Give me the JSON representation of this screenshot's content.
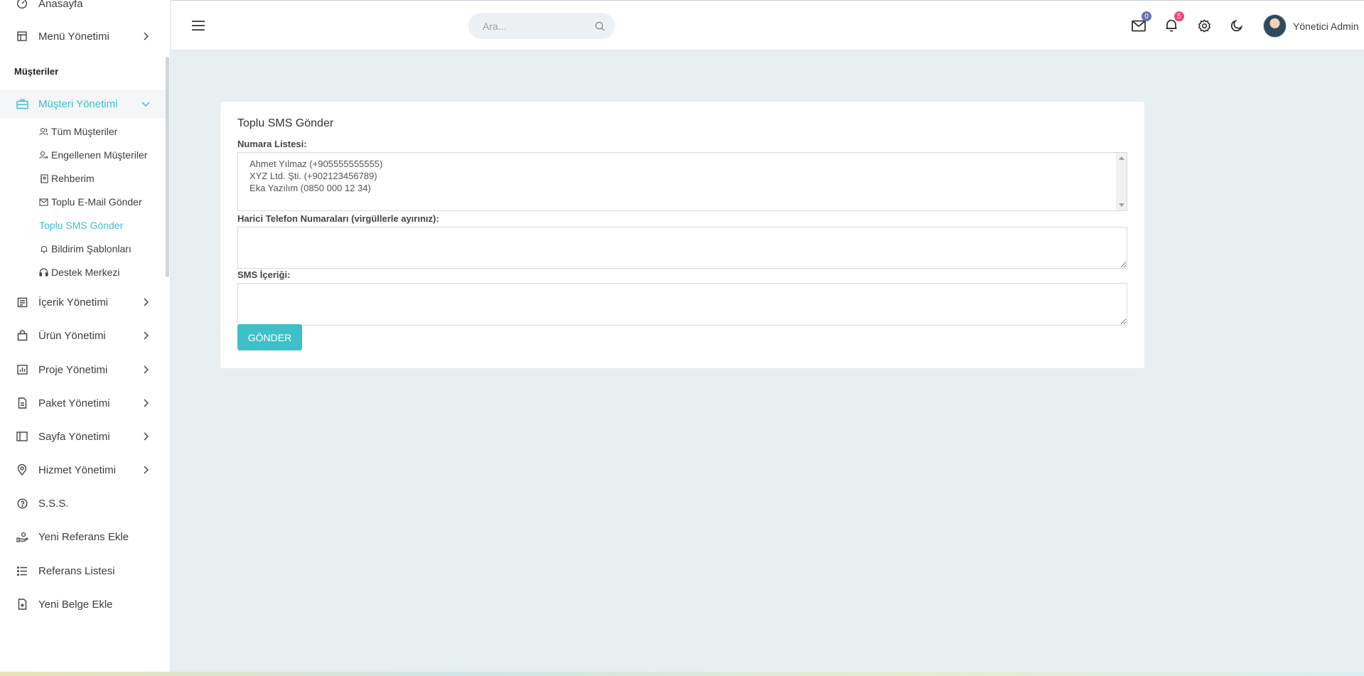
{
  "sidebar": {
    "top_items": [
      {
        "label": "Anasayfa",
        "icon": "dashboard-icon"
      },
      {
        "label": "Menü Yönetimi",
        "icon": "layout-icon"
      }
    ],
    "section_title": "Müşteriler",
    "active_group": {
      "label": "Müşteri Yönetimi",
      "icon": "briefcase-icon"
    },
    "sub_items": [
      {
        "label": "Tüm Müşteriler",
        "icon": "users-icon"
      },
      {
        "label": "Engellenen Müşteriler",
        "icon": "user-x-icon"
      },
      {
        "label": "Rehberim",
        "icon": "contacts-book-icon"
      },
      {
        "label": "Toplu E-Mail Gönder",
        "icon": "mail-icon"
      },
      {
        "label": "Toplu SMS Gönder",
        "icon": ""
      },
      {
        "label": "Bildirim Şablonları",
        "icon": "bell-icon"
      },
      {
        "label": "Destek Merkezi",
        "icon": "headset-icon"
      }
    ],
    "bottom_items": [
      {
        "label": "İçerik Yönetimi",
        "icon": "content-icon"
      },
      {
        "label": "Ürün Yönetimi",
        "icon": "shopping-bag-icon"
      },
      {
        "label": "Proje Yönetimi",
        "icon": "bar-chart-icon"
      },
      {
        "label": "Paket Yönetimi",
        "icon": "document-icon"
      },
      {
        "label": "Sayfa Yönetimi",
        "icon": "sidebar-layout-icon"
      },
      {
        "label": "Hizmet Yönetimi",
        "icon": "map-pin-icon"
      },
      {
        "label": "S.S.S.",
        "icon": "question-circle-icon"
      },
      {
        "label": "Yeni Referans Ekle",
        "icon": "hand-coin-icon"
      },
      {
        "label": "Referans Listesi",
        "icon": "list-icon"
      },
      {
        "label": "Yeni Belge Ekle",
        "icon": "file-plus-icon"
      }
    ]
  },
  "header": {
    "search_placeholder": "Ara...",
    "mail_badge": "0",
    "notification_badge": "5",
    "user_name": "Yönetici Admin",
    "colors": {
      "mail_badge": "#6c6fb8",
      "notification_badge": "#f0457a"
    }
  },
  "card": {
    "title": "Toplu SMS Gönder",
    "number_list_label": "Numara Listesi:",
    "number_list": [
      "Ahmet Yılmaz (+905555555555)",
      "XYZ Ltd. Şti. (+902123456789)",
      "Eka Yazılım (0850 000 12 34)"
    ],
    "external_numbers_label": "Harici Telefon Numaraları (virgüllerle ayırınız):",
    "external_numbers_value": "",
    "sms_content_label": "SMS İçeriği:",
    "sms_content_value": "",
    "send_button": "GÖNDER"
  },
  "colors": {
    "accent": "#3ec0c8",
    "background": "#e8eff0"
  }
}
